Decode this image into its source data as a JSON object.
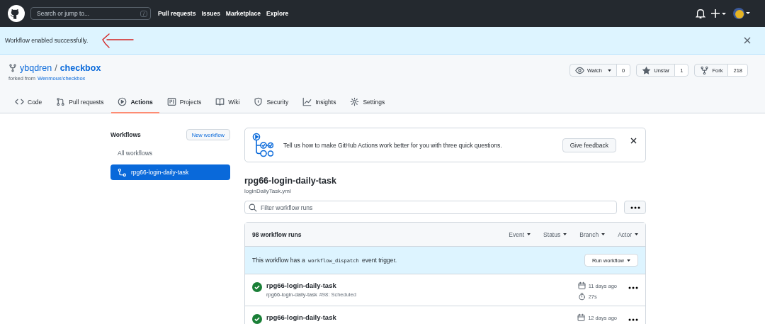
{
  "header": {
    "search_placeholder": "Search or jump to...",
    "search_key": "/",
    "nav": [
      "Pull requests",
      "Issues",
      "Marketplace",
      "Explore"
    ]
  },
  "flash": {
    "message": "Workflow enabled successfully."
  },
  "repo": {
    "owner": "ybqdren",
    "separator": "/",
    "name": "checkbox",
    "forked_label": "forked from",
    "forked_from": "Wenmoux/checkbox",
    "actions": [
      {
        "kind": "watch",
        "label": "Watch",
        "count": "0"
      },
      {
        "kind": "star",
        "label": "Unstar",
        "count": "1"
      },
      {
        "kind": "fork",
        "label": "Fork",
        "count": "218"
      }
    ]
  },
  "tabs": [
    {
      "kind": "code",
      "label": "Code",
      "selected": false
    },
    {
      "kind": "pull",
      "label": "Pull requests",
      "selected": false
    },
    {
      "kind": "actions",
      "label": "Actions",
      "selected": true
    },
    {
      "kind": "projects",
      "label": "Projects",
      "selected": false
    },
    {
      "kind": "wiki",
      "label": "Wiki",
      "selected": false
    },
    {
      "kind": "security",
      "label": "Security",
      "selected": false
    },
    {
      "kind": "insights",
      "label": "Insights",
      "selected": false
    },
    {
      "kind": "settings",
      "label": "Settings",
      "selected": false
    }
  ],
  "sidebar": {
    "title": "Workflows",
    "new_button": "New workflow",
    "items": [
      {
        "kind": "all",
        "label": "All workflows",
        "selected": false
      },
      {
        "kind": "workflow",
        "label": "rpg66-login-daily-task",
        "selected": true
      }
    ]
  },
  "feedback": {
    "message": "Tell us how to make GitHub Actions work better for you with three quick questions.",
    "button": "Give feedback"
  },
  "workflow": {
    "title": "rpg66-login-daily-task",
    "file": "loginDaliyTask.yml"
  },
  "filter": {
    "placeholder": "Filter workflow runs"
  },
  "runs": {
    "count": "98 workflow runs",
    "filters": [
      "Event",
      "Status",
      "Branch",
      "Actor"
    ],
    "dispatch": {
      "before": "This workflow has a",
      "code": "workflow_dispatch",
      "after": "event trigger.",
      "button": "Run workflow"
    },
    "items": [
      {
        "kind": "success",
        "title": "rpg66-login-daily-task",
        "workflow": "rpg66-login-daily-task",
        "detail": "#98: Scheduled",
        "date": "11 days ago",
        "duration": "27s"
      },
      {
        "kind": "success",
        "title": "rpg66-login-daily-task",
        "date": "12 days ago"
      }
    ]
  }
}
